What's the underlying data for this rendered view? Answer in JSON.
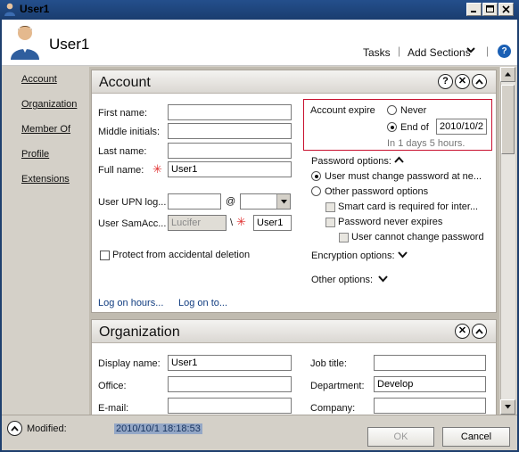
{
  "window": {
    "title": "User1"
  },
  "header": {
    "name": "User1",
    "tasks": "Tasks",
    "separator": "|",
    "add_sections": "Add Sections"
  },
  "nav": [
    {
      "label": "Account"
    },
    {
      "label": "Organization"
    },
    {
      "label": "Member Of"
    },
    {
      "label": "Profile"
    },
    {
      "label": "Extensions"
    }
  ],
  "account": {
    "title": "Account",
    "first_name_label": "First name:",
    "first_name": "",
    "middle_initials_label": "Middle initials:",
    "middle_initials": "",
    "last_name_label": "Last name:",
    "last_name": "",
    "full_name_label": "Full name:",
    "full_name": "User1",
    "upn_label": "User UPN log...",
    "upn_prefix": "",
    "at": "@",
    "upn_domain": "",
    "sam_label": "User SamAcc...",
    "sam_domain": "Lucifer",
    "backslash": "\\",
    "sam_name": "User1",
    "protect_label": "Protect from accidental deletion",
    "logon_hours": "Log on hours...",
    "logon_to": "Log on to...",
    "expire_label": "Account expire",
    "never": "Never",
    "end_of": "End of",
    "end_date": "2010/10/2",
    "remaining": "In 1 days 5 hours.",
    "password_options": "Password options:",
    "must_change": "User must change password at ne...",
    "other_pw": "Other password options",
    "smart_card": "Smart card is required for inter...",
    "pw_never_expires": "Password never expires",
    "cannot_change": "User cannot change password",
    "encryption": "Encryption options:",
    "other_options": "Other options:"
  },
  "organization": {
    "title": "Organization",
    "display_name_label": "Display name:",
    "display_name": "User1",
    "office_label": "Office:",
    "office": "",
    "email_label": "E-mail:",
    "email": "",
    "job_title_label": "Job title:",
    "job_title": "",
    "department_label": "Department:",
    "department": "Develop",
    "company_label": "Company:",
    "company": ""
  },
  "footer": {
    "modified_label": "Modified:",
    "modified_value": "2010/10/1 18:18:53",
    "ok": "OK",
    "cancel": "Cancel"
  }
}
